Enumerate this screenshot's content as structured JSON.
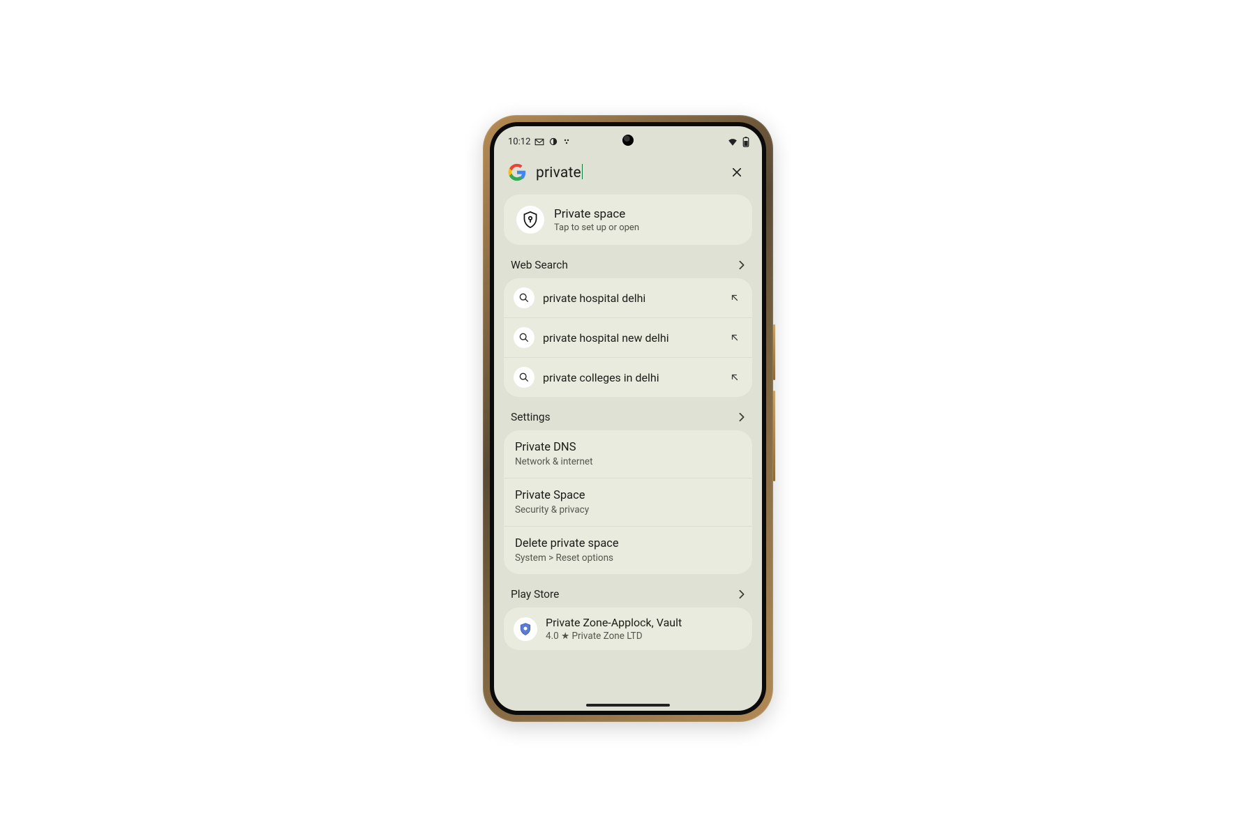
{
  "statusbar": {
    "time": "10:12",
    "icons": [
      "gmail",
      "circle",
      "dots"
    ]
  },
  "search": {
    "query": "private"
  },
  "hero": {
    "title": "Private space",
    "subtitle": "Tap to set up or open"
  },
  "sections": {
    "web": {
      "header": "Web Search",
      "items": [
        {
          "label": "private hospital delhi"
        },
        {
          "label": "private hospital new delhi"
        },
        {
          "label": "private colleges in delhi"
        }
      ]
    },
    "settings": {
      "header": "Settings",
      "items": [
        {
          "title": "Private DNS",
          "subtitle": "Network & internet"
        },
        {
          "title": "Private Space",
          "subtitle": "Security & privacy"
        },
        {
          "title": "Delete private space",
          "subtitle": "System > Reset options"
        }
      ]
    },
    "play": {
      "header": "Play Store",
      "items": [
        {
          "title": "Private Zone-Applock, Vault",
          "subtitle": "4.0 ★ Private Zone LTD"
        }
      ]
    }
  }
}
